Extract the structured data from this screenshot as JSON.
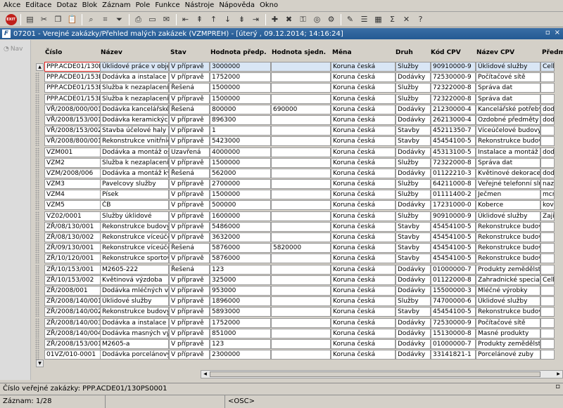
{
  "menu": [
    "Akce",
    "Editace",
    "Dotaz",
    "Blok",
    "Záznam",
    "Pole",
    "Funkce",
    "Nástroje",
    "Nápověda",
    "Okno"
  ],
  "window": {
    "title": "07201 - Verejné zakázky/Přehled malých zakázek (VZMPREH) - [úterý  , 09.12.2014; 14:16:24]",
    "restore": "▫",
    "close": "×"
  },
  "nav": {
    "label": "Nav"
  },
  "columns": [
    "Číslo",
    "Název",
    "Stav",
    "Hodnota předp.",
    "Hodnota sjedn.",
    "Měna",
    "Druh",
    "Kód CPV",
    "Název CPV",
    "Předm"
  ],
  "rows": [
    [
      "PPP.ACDE01/130PS",
      "Úklidové práce v objektu",
      "V přípravě",
      "3000000",
      "",
      "Koruna česká",
      "Služby",
      "90910000-9",
      "Úklidové služby",
      "Celko"
    ],
    [
      "PPP.ACDE01/153PS",
      "Dodávka a instalace poč",
      "V přípravě",
      "1752000",
      "",
      "Koruna česká",
      "Dodávky",
      "72530000-9",
      "Počítačové sítě",
      ""
    ],
    [
      "PPP.ACDE01/153PS",
      "Služba k nezaplacení AA",
      "Řešená",
      "1500000",
      "",
      "Koruna česká",
      "Služby",
      "72322000-8",
      "Správa dat",
      ""
    ],
    [
      "PPP.ACDE01/153PS",
      "Služba k nezaplacení BBI",
      "V přípravě",
      "1500000",
      "",
      "Koruna česká",
      "Služby",
      "72322000-8",
      "Správa dat",
      ""
    ],
    [
      "VŘ/2008/000/001",
      "Dodávka kancelářského n",
      "Řešená",
      "800000",
      "690000",
      "Koruna česká",
      "Dodávky",
      "21230000-4",
      "Kancelářské potřeby z",
      "dodá"
    ],
    [
      "VŘ/2008/153/001",
      "Dodávka keramických oz",
      "V přípravě",
      "896300",
      "",
      "Koruna česká",
      "Dodávky",
      "26213000-4",
      "Ozdobné předměty z ke",
      "dodá"
    ],
    [
      "VŘ/2008/153/002",
      "Stavba účelové haly",
      "V přípravě",
      "1",
      "",
      "Koruna česká",
      "Stavby",
      "45211350-7",
      "Víceúčelové budovy",
      ""
    ],
    [
      "VŘ/2008/800/001",
      "Rekonstrukce vnitřních p",
      "V přípravě",
      "5423000",
      "",
      "Koruna česká",
      "Stavby",
      "45454100-5",
      "Rekonstrukce budov",
      ""
    ],
    [
      "VZM001",
      "Dodávka a montáž osobn",
      "Uzavřená",
      "4000000",
      "",
      "Koruna česká",
      "Dodávky",
      "45313100-5",
      "Instalace a montáž výta",
      "dodá"
    ],
    [
      "VZM2",
      "Služba k nezaplacení",
      "V přípravě",
      "1500000",
      "",
      "Koruna česká",
      "Služby",
      "72322000-8",
      "Správa dat",
      ""
    ],
    [
      "VZM/2008/006",
      "Dodávka a montáž květin",
      "Řešená",
      "562000",
      "",
      "Koruna česká",
      "Dodávky",
      "01122210-3",
      "Květinové dekorace",
      "dodá"
    ],
    [
      "VZM3",
      "Pavelcovy služby",
      "V přípravě",
      "2700000",
      "",
      "Koruna česká",
      "Služby",
      "64211000-8",
      "Veřejné telefonní služb",
      "naza"
    ],
    [
      "VZM4",
      "Písek",
      "V přípravě",
      "1500000",
      "",
      "Koruna česká",
      "Služby",
      "01111400-2",
      "Ječmen",
      "mcmo"
    ],
    [
      "VZM5",
      "ČB",
      "V přípravě",
      "500000",
      "",
      "Koruna česká",
      "Dodávky",
      "17231000-0",
      "Koberce",
      "kovra"
    ],
    [
      "VZ02/0001",
      "Služby úklidové",
      "V přípravě",
      "1600000",
      "",
      "Koruna česká",
      "Služby",
      "90910000-9",
      "Úklidové služby",
      "Zajiš"
    ],
    [
      "ZŘ/08/130/001",
      "Rekonstrukce budovy ve",
      "V přípravě",
      "5486000",
      "",
      "Koruna česká",
      "Stavby",
      "45454100-5",
      "Rekonstrukce budov",
      ""
    ],
    [
      "ZŘ/08/130/002",
      "Rekonstrukce víceúčelov",
      "V přípravě",
      "3632000",
      "",
      "Koruna česká",
      "Stavby",
      "45454100-5",
      "Rekonstrukce budov",
      ""
    ],
    [
      "ZŘ/09/130/001",
      "Rekonstrukce víceúčelov",
      "Řešená",
      "5876000",
      "5820000",
      "Koruna česká",
      "Stavby",
      "45454100-5",
      "Rekonstrukce budov",
      ""
    ],
    [
      "ZŘ/10/120/001",
      "Rekonstrukce sportovní h",
      "V přípravě",
      "5876000",
      "",
      "Koruna česká",
      "Stavby",
      "45454100-5",
      "Rekonstrukce budov",
      ""
    ],
    [
      "ZŘ/10/153/001",
      "M2605-222",
      "Řešená",
      "123",
      "",
      "Koruna česká",
      "Dodávky",
      "01000000-7",
      "Produkty zemědělství, r",
      ""
    ],
    [
      "ZŘ/10/153/002",
      "Květinová výzdoba",
      "V přípravě",
      "325000",
      "",
      "Koruna česká",
      "Dodávky",
      "01122000-8",
      "Zahradnické speciality",
      "Celko"
    ],
    [
      "ZŘ/2008/001",
      "Dodávka mléčných výrob",
      "V přípravě",
      "953000",
      "",
      "Koruna česká",
      "Dodávky",
      "15500000-3",
      "Mléčné výrobky",
      ""
    ],
    [
      "ZŘ/2008/140/001",
      "Úklidové služby",
      "V přípravě",
      "1896000",
      "",
      "Koruna česká",
      "Služby",
      "74700000-6",
      "Úklidové služby",
      ""
    ],
    [
      "ZŘ/2008/140/002",
      "Rekonstrukce budovy ve",
      "V přípravě",
      "5893000",
      "",
      "Koruna česká",
      "Stavby",
      "45454100-5",
      "Rekonstrukce budov",
      ""
    ],
    [
      "ZŘ/2008/140/003",
      "Dodávka a instalace poč",
      "V přípravě",
      "1752000",
      "",
      "Koruna česká",
      "Dodávky",
      "72530000-9",
      "Počítačové sítě",
      ""
    ],
    [
      "ZŘ/2008/140/004",
      "Dodávka masných výrob",
      "V přípravě",
      "851000",
      "",
      "Koruna česká",
      "Dodávky",
      "15130000-8",
      "Masné produkty",
      ""
    ],
    [
      "ZŘ/2008/153/001",
      "M2605-a",
      "V přípravě",
      "123",
      "",
      "Koruna česká",
      "Dodávky",
      "01000000-7",
      "Produkty zemědělství, r",
      ""
    ],
    [
      "01VZ/010-0001",
      "Dodávka porcelánových",
      "V přípravě",
      "2300000",
      "",
      "Koruna česká",
      "Dodávky",
      "33141821-1",
      "Porcelánové zuby",
      ""
    ]
  ],
  "status": {
    "field_hint": "Číslo veřejné zakázky: PPP.ACDE01/130PS0001",
    "record": "Záznam: 1/28",
    "osc": "<OSC>"
  }
}
